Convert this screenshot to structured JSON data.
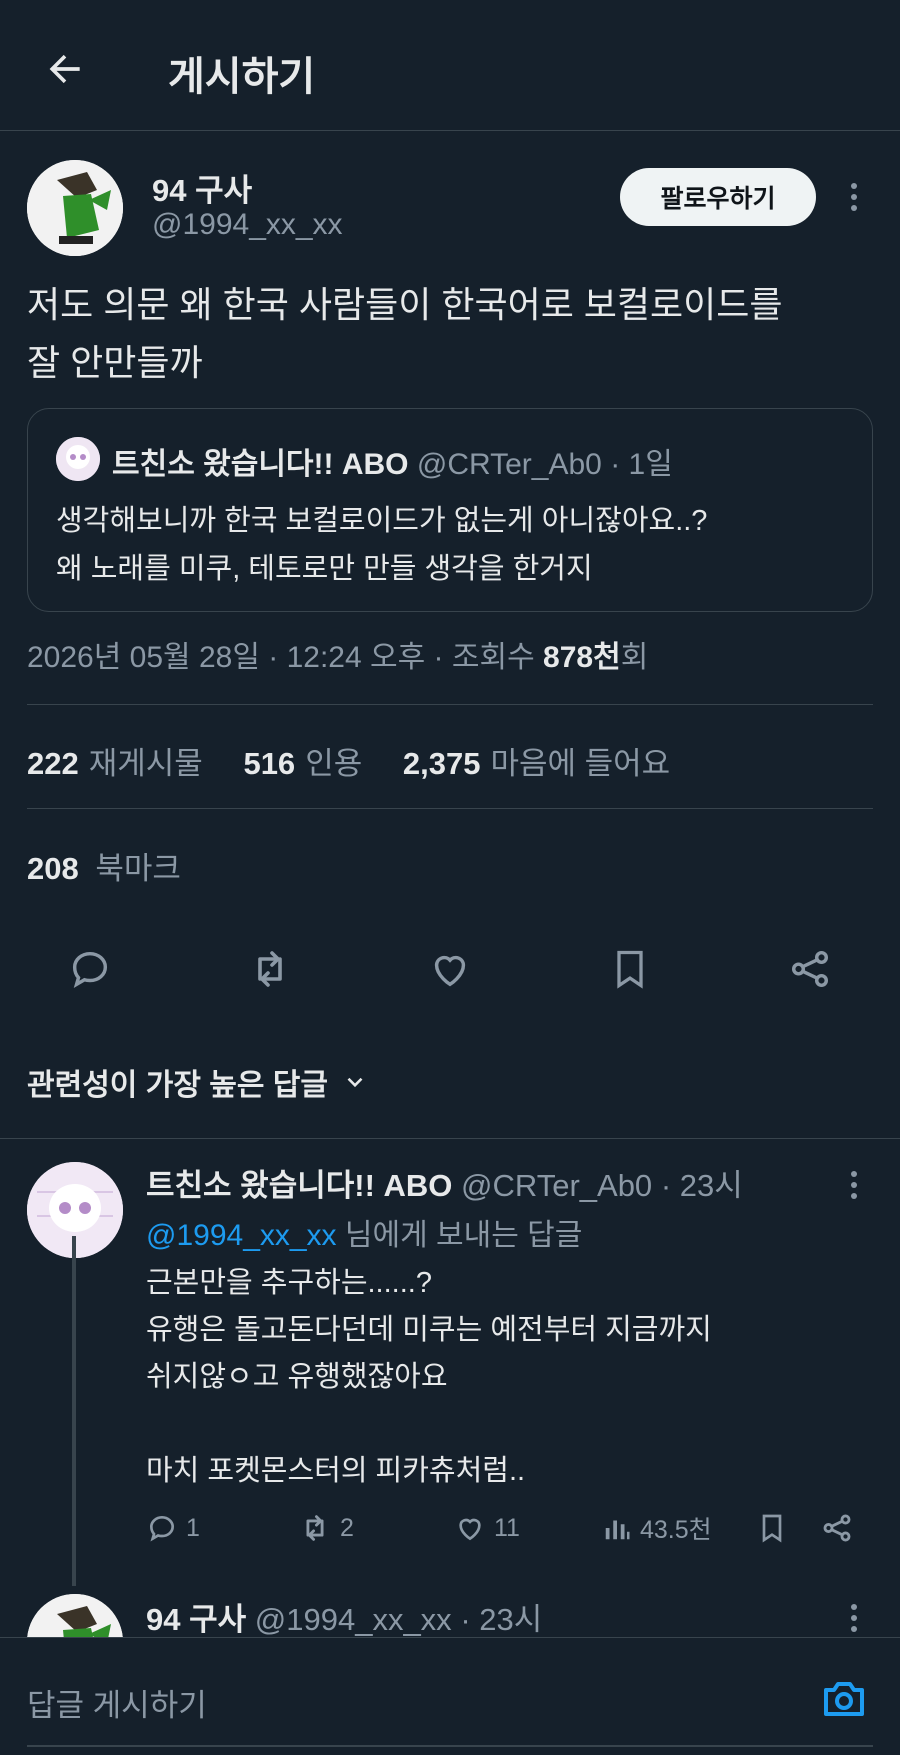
{
  "header": {
    "title": "게시하기"
  },
  "post": {
    "author_name": "94 구사",
    "author_handle": "@1994_xx_xx",
    "follow_label": "팔로우하기",
    "text_line1": "저도 의문 왜 한국 사람들이 한국어로 보컬로이드를",
    "text_line2": "잘 안만들까",
    "quote": {
      "author_name": "트친소 왔습니다!! ABO",
      "author_handle": "@CRTer_Ab0",
      "time": "· 1일",
      "line1": "생각해보니까 한국 보컬로이드가 없는게 아니잖아요..?",
      "line2": "왜 노래를 미쿠, 테토로만 만들 생각을 한거지"
    },
    "timestamp": "2026년 05월 28일 · 12:24 오후 · 조회수",
    "views_num": "878천",
    "views_suffix": "회",
    "stats": {
      "reposts_num": "222",
      "reposts_label": "재게시물",
      "quotes_num": "516",
      "quotes_label": "인용",
      "likes_num": "2,375",
      "likes_label": "마음에 들어요",
      "bookmarks_num": "208",
      "bookmarks_label": "북마크"
    }
  },
  "sort_label": "관련성이 가장 높은 답글",
  "reply": {
    "author_name": "트친소 왔습니다!! ABO",
    "author_handle": "@CRTer_Ab0",
    "time": "· 23시",
    "reply_to_mention": "@1994_xx_xx",
    "reply_to_suffix": "님에게 보내는 답글",
    "line1": "근본만을 추구하는......?",
    "line2": "유행은 돌고돈다던데 미쿠는 예전부터 지금까지",
    "line3": "쉬지않ㅇ고 유행했잖아요",
    "line4": "마치 포켓몬스터의 피카츄처럼..",
    "replies": "1",
    "reposts": "2",
    "likes": "11",
    "views": "43.5천"
  },
  "reply2": {
    "author_name": "94 구사",
    "author_handle": "@1994_xx_xx",
    "time": "· 23시"
  },
  "composer": {
    "placeholder": "답글 게시하기"
  },
  "colors": {
    "background": "#15202b",
    "accent": "#1d9bf0",
    "border": "#38444d",
    "muted": "#8b98a5"
  }
}
